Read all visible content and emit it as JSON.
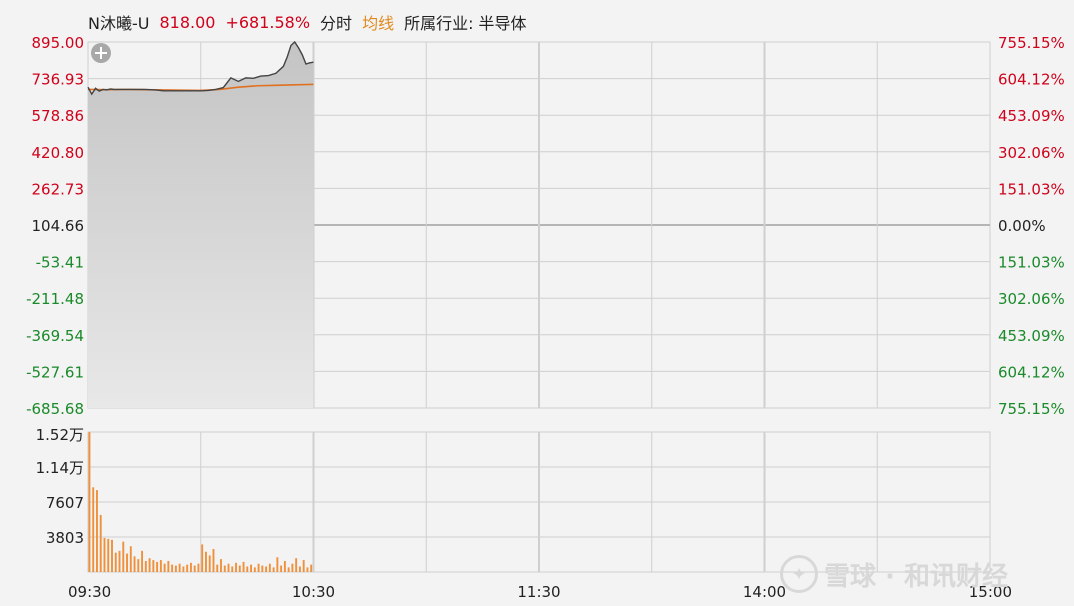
{
  "header": {
    "name": "N沐曦-U",
    "price": "818.00",
    "change_pct": "+681.58%",
    "tab_time": "分时",
    "tab_avg": "均线",
    "industry": "所属行业: 半导体"
  },
  "watermark": "雪球 · 和讯财经",
  "colors": {
    "up": "#d0021b",
    "down": "#1a8a2a",
    "volume": "#f0903a",
    "avg_line": "#e07020",
    "price_line": "#444444",
    "grid": "#cfcfcf"
  },
  "chart_data": [
    {
      "type": "line",
      "title": "",
      "y_left_ticks": [
        "895.00",
        "736.93",
        "578.86",
        "420.80",
        "262.73",
        "104.66",
        "-53.41",
        "-211.48",
        "-369.54",
        "-527.61",
        "-685.68"
      ],
      "y_right_ticks": [
        "755.15%",
        "604.12%",
        "453.09%",
        "302.06%",
        "151.03%",
        "0.00%",
        "151.03%",
        "302.06%",
        "453.09%",
        "604.12%",
        "755.15%"
      ],
      "ylim": [
        -685.68,
        895.0
      ],
      "x_ticks": [
        "09:30",
        "10:30",
        "11:30",
        "14:00",
        "15:00"
      ],
      "x_label_minutes": [
        0,
        60,
        120,
        180,
        240
      ],
      "grid": true,
      "series": [
        {
          "name": "",
          "x": [
            0,
            1,
            2,
            3,
            4,
            5,
            6,
            7,
            8,
            9,
            10,
            12,
            15,
            18,
            20,
            22,
            25,
            28,
            30,
            32,
            34,
            36,
            38,
            40,
            42,
            44,
            46,
            48,
            50,
            52,
            53,
            54,
            55,
            56,
            57,
            58,
            59,
            60
          ],
          "values": [
            700,
            670,
            695,
            683,
            690,
            688,
            692,
            690,
            690,
            690,
            690,
            690,
            690,
            688,
            684,
            684,
            684,
            684,
            684,
            686,
            690,
            698,
            740,
            725,
            740,
            738,
            748,
            750,
            760,
            790,
            830,
            880,
            895,
            870,
            840,
            800,
            805,
            808
          ]
        },
        {
          "name": "均线",
          "x": [
            0,
            5,
            10,
            20,
            30,
            35,
            40,
            45,
            50,
            55,
            60
          ],
          "values": [
            690,
            689,
            690,
            688,
            686,
            690,
            700,
            706,
            708,
            710,
            712
          ]
        }
      ]
    },
    {
      "type": "bar",
      "title": "",
      "y_ticks": [
        "1.52万",
        "1.14万",
        "7607",
        "3803"
      ],
      "ylim": [
        0,
        15215
      ],
      "grid": true,
      "x": [
        0,
        1,
        2,
        3,
        4,
        5,
        6,
        7,
        8,
        9,
        10,
        11,
        12,
        13,
        14,
        15,
        16,
        17,
        18,
        19,
        20,
        21,
        22,
        23,
        24,
        25,
        26,
        27,
        28,
        29,
        30,
        31,
        32,
        33,
        34,
        35,
        36,
        37,
        38,
        39,
        40,
        41,
        42,
        43,
        44,
        45,
        46,
        47,
        48,
        49,
        50,
        51,
        52,
        53,
        54,
        55,
        56,
        57,
        58,
        59
      ],
      "values": [
        15200,
        9200,
        8900,
        6200,
        3700,
        3600,
        3500,
        2100,
        2300,
        3300,
        2000,
        2800,
        1700,
        1400,
        2300,
        1200,
        1500,
        1300,
        1100,
        1300,
        900,
        1200,
        800,
        700,
        900,
        600,
        800,
        1000,
        700,
        900,
        3000,
        2200,
        1800,
        2500,
        800,
        1400,
        700,
        900,
        600,
        1000,
        700,
        1100,
        600,
        800,
        500,
        900,
        700,
        600,
        900,
        500,
        1600,
        700,
        1200,
        500,
        900,
        1500,
        600,
        1300,
        500,
        800
      ]
    }
  ]
}
